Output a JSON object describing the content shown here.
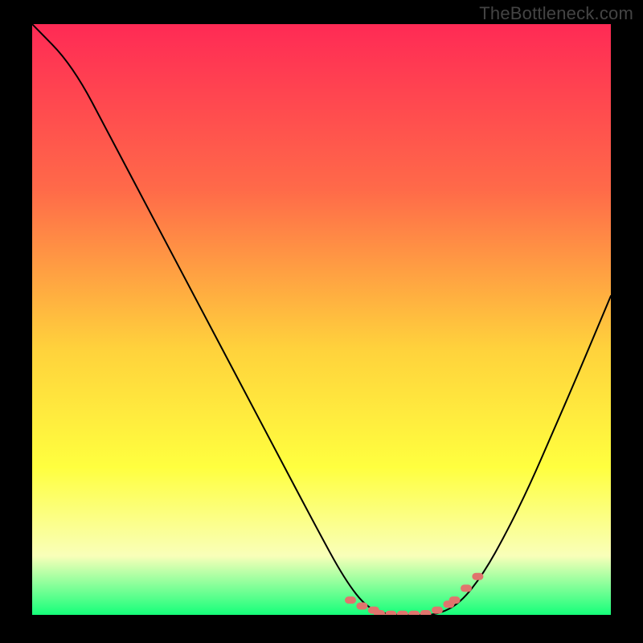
{
  "watermark": "TheBottleneck.com",
  "colors": {
    "gradient_top": "#ff2a55",
    "gradient_mid1": "#ff6a49",
    "gradient_mid2": "#ffd23c",
    "gradient_mid3": "#ffff3f",
    "gradient_mid4": "#f9ffb9",
    "gradient_bottom": "#15ff7a",
    "curve": "#000000",
    "markers": "#e0746d"
  },
  "chart_data": {
    "type": "line",
    "title": "",
    "xlabel": "",
    "ylabel": "",
    "ylim": [
      0,
      100
    ],
    "xlim": [
      0,
      100
    ],
    "series": [
      {
        "name": "curve",
        "x": [
          0,
          7,
          14,
          21,
          28,
          35,
          42,
          49,
          54,
          58,
          62,
          66,
          70,
          74,
          78,
          82,
          86,
          90,
          94,
          100
        ],
        "values": [
          100,
          93,
          80,
          67,
          54,
          41,
          28,
          15,
          6,
          1,
          0,
          0,
          0,
          2,
          7,
          14,
          22,
          31,
          40,
          54
        ]
      }
    ],
    "flat_segment_x": [
      56,
      74
    ],
    "marker_clusters": [
      {
        "x": [
          55,
          57,
          59
        ],
        "y": [
          2.5,
          1.5,
          0.8
        ]
      },
      {
        "x": [
          60,
          62,
          64,
          66,
          68,
          70,
          72
        ],
        "y": [
          0.2,
          0.1,
          0.1,
          0.1,
          0.2,
          0.8,
          1.8
        ]
      },
      {
        "x": [
          73,
          75,
          77
        ],
        "y": [
          2.5,
          4.5,
          6.5
        ]
      }
    ]
  }
}
